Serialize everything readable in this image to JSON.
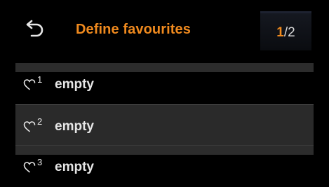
{
  "header": {
    "title": "Define favourites",
    "back_icon": "back-arrow-icon"
  },
  "pager": {
    "current": "1",
    "separator": "/",
    "total": "2"
  },
  "favourites": [
    {
      "number": "1",
      "label": "empty",
      "icon": "heart-outline-icon",
      "selected": false
    },
    {
      "number": "2",
      "label": "empty",
      "icon": "heart-outline-icon",
      "selected": true
    },
    {
      "number": "3",
      "label": "empty",
      "icon": "heart-outline-icon",
      "selected": false
    }
  ],
  "colors": {
    "accent": "#f08a1e",
    "text": "#e6e6e6",
    "background": "#000000",
    "selected_row": "#2a2a2a"
  }
}
